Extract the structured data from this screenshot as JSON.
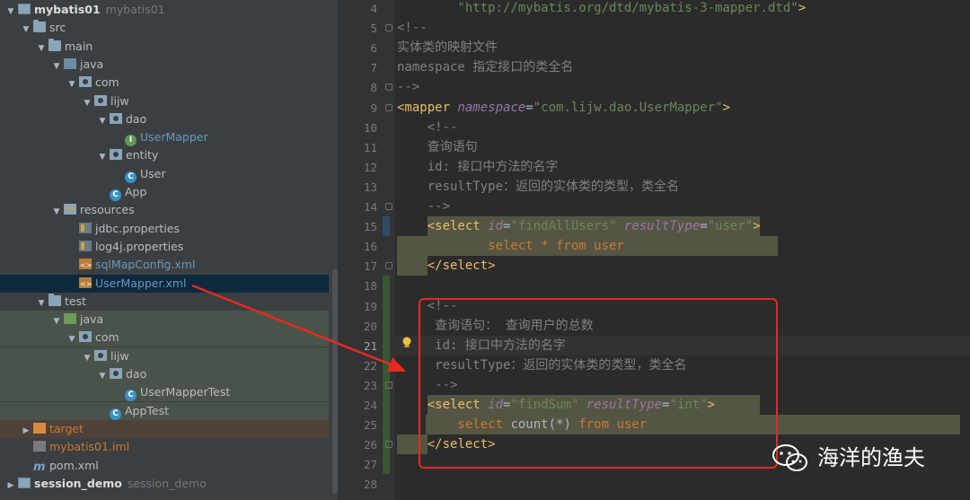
{
  "tree": [
    {
      "depth": 0,
      "twisty": "▼",
      "icon": "module",
      "label": "mybatis01",
      "sub": "mybatis01",
      "style": "bold"
    },
    {
      "depth": 1,
      "twisty": "▼",
      "icon": "folder",
      "label": "src"
    },
    {
      "depth": 2,
      "twisty": "▼",
      "icon": "folder",
      "label": "main"
    },
    {
      "depth": 3,
      "twisty": "▼",
      "icon": "folder-src",
      "label": "java"
    },
    {
      "depth": 4,
      "twisty": "▼",
      "icon": "pkg",
      "label": "com"
    },
    {
      "depth": 5,
      "twisty": "▼",
      "icon": "pkg",
      "label": "lijw"
    },
    {
      "depth": 6,
      "twisty": "▼",
      "icon": "pkg",
      "label": "dao"
    },
    {
      "depth": 7,
      "twisty": "",
      "icon": "ifc",
      "label": "UserMapper",
      "style": "blue"
    },
    {
      "depth": 6,
      "twisty": "▼",
      "icon": "pkg",
      "label": "entity"
    },
    {
      "depth": 7,
      "twisty": "",
      "icon": "cls",
      "label": "User"
    },
    {
      "depth": 6,
      "twisty": "",
      "icon": "cls",
      "label": "App"
    },
    {
      "depth": 3,
      "twisty": "▼",
      "icon": "folder-res",
      "label": "resources"
    },
    {
      "depth": 4,
      "twisty": "",
      "icon": "props",
      "label": "jdbc.properties"
    },
    {
      "depth": 4,
      "twisty": "",
      "icon": "props",
      "label": "log4j.properties"
    },
    {
      "depth": 4,
      "twisty": "",
      "icon": "xml",
      "label": "sqlMapConfig.xml",
      "style": "blue"
    },
    {
      "depth": 4,
      "twisty": "",
      "icon": "xml",
      "label": "UserMapper.xml",
      "style": "blue",
      "selected": true
    },
    {
      "depth": 2,
      "twisty": "▼",
      "icon": "folder",
      "label": "test"
    },
    {
      "depth": 3,
      "twisty": "▼",
      "icon": "folder-test",
      "label": "java",
      "bg": "test"
    },
    {
      "depth": 4,
      "twisty": "▼",
      "icon": "pkg",
      "label": "com",
      "bg": "test"
    },
    {
      "depth": 5,
      "twisty": "▼",
      "icon": "pkg",
      "label": "lijw",
      "bg": "test"
    },
    {
      "depth": 6,
      "twisty": "▼",
      "icon": "pkg",
      "label": "dao",
      "bg": "test"
    },
    {
      "depth": 7,
      "twisty": "",
      "icon": "cls",
      "label": "UserMapperTest",
      "bg": "test"
    },
    {
      "depth": 6,
      "twisty": "",
      "icon": "cls",
      "label": "AppTest",
      "bg": "test"
    },
    {
      "depth": 1,
      "twisty": "▶",
      "icon": "folder-target",
      "label": "target",
      "style": "tgt",
      "bg": "target"
    },
    {
      "depth": 1,
      "twisty": "",
      "icon": "iml",
      "label": "mybatis01.iml",
      "style": "tgt"
    },
    {
      "depth": 1,
      "twisty": "",
      "icon": "mvn",
      "label": "pom.xml"
    },
    {
      "depth": 0,
      "twisty": "▶",
      "icon": "module",
      "label": "session_demo",
      "sub": "session_demo",
      "style": "bold"
    }
  ],
  "editor": {
    "line_numbers": [
      "4",
      "5",
      "6",
      "7",
      "8",
      "9",
      "10",
      "11",
      "12",
      "13",
      "14",
      "15",
      "16",
      "17",
      "18",
      "19",
      "20",
      "21",
      "22",
      "23",
      "24",
      "25",
      "26",
      "27",
      "28"
    ],
    "lines": [
      [
        [
          "t-str",
          "        \"http://mybatis.org/dtd/mybatis-3-mapper.dtd\""
        ],
        [
          "t-tag",
          ">"
        ]
      ],
      [
        [
          "t-com",
          "<!--"
        ]
      ],
      [
        [
          "t-com",
          "实体类的映射文件"
        ]
      ],
      [
        [
          "t-com",
          "namespace 指定接口的类全名"
        ]
      ],
      [
        [
          "t-com",
          "-->"
        ]
      ],
      [
        [
          "t-tag",
          "<mapper "
        ],
        [
          "t-attr",
          "namespace"
        ],
        [
          "t-cn",
          "="
        ],
        [
          "t-str",
          "\"com.lijw.dao.UserMapper\""
        ],
        [
          "t-tag",
          ">"
        ]
      ],
      [
        [
          "t-com",
          "    <!--"
        ]
      ],
      [
        [
          "t-com",
          "    查询语句"
        ]
      ],
      [
        [
          "t-com",
          "    id: 接口中方法的名字"
        ]
      ],
      [
        [
          "t-com",
          "    resultType：返回的实体类的类型，类全名"
        ]
      ],
      [
        [
          "t-com",
          "    -->"
        ]
      ],
      [
        [
          "t-tag",
          "    <select "
        ],
        [
          "t-attr",
          "id"
        ],
        [
          "t-cn",
          "="
        ],
        [
          "t-str",
          "\"findAllUsers\" "
        ],
        [
          "t-attr",
          "resultType"
        ],
        [
          "t-cn",
          "="
        ],
        [
          "t-str",
          "\"user\""
        ],
        [
          "t-tag",
          ">"
        ]
      ],
      [
        [
          "t-kw",
          "            select * from user"
        ]
      ],
      [
        [
          "t-tag",
          "    </select>"
        ]
      ],
      [
        [
          "t-cn",
          ""
        ]
      ],
      [
        [
          "t-com",
          "    <!--"
        ]
      ],
      [
        [
          "t-com",
          "     查询语句： 查询用户的总数"
        ]
      ],
      [
        [
          "t-com",
          "     id: 接口中方法的名字"
        ]
      ],
      [
        [
          "t-com",
          "     resultType：返回的实体类的类型，类全名"
        ]
      ],
      [
        [
          "t-com",
          "     -->"
        ]
      ],
      [
        [
          "t-tag",
          "    <select "
        ],
        [
          "t-attr",
          "id"
        ],
        [
          "t-cn",
          "="
        ],
        [
          "t-str",
          "\"findSum\" "
        ],
        [
          "t-attr",
          "resultType"
        ],
        [
          "t-cn",
          "="
        ],
        [
          "t-str",
          "\"int\""
        ],
        [
          "t-tag",
          ">"
        ]
      ],
      [
        [
          "t-kw",
          "        select "
        ],
        [
          "t-cn",
          "count(*) "
        ],
        [
          "t-kw",
          "from user"
        ]
      ],
      [
        [
          "t-tag",
          "    </select>"
        ]
      ],
      [
        [
          "t-cn",
          ""
        ]
      ],
      [
        [
          "t-cn",
          ""
        ]
      ]
    ]
  },
  "watermark": "海洋的渔夫",
  "colors": {
    "annotation_red": "#e62a20"
  }
}
